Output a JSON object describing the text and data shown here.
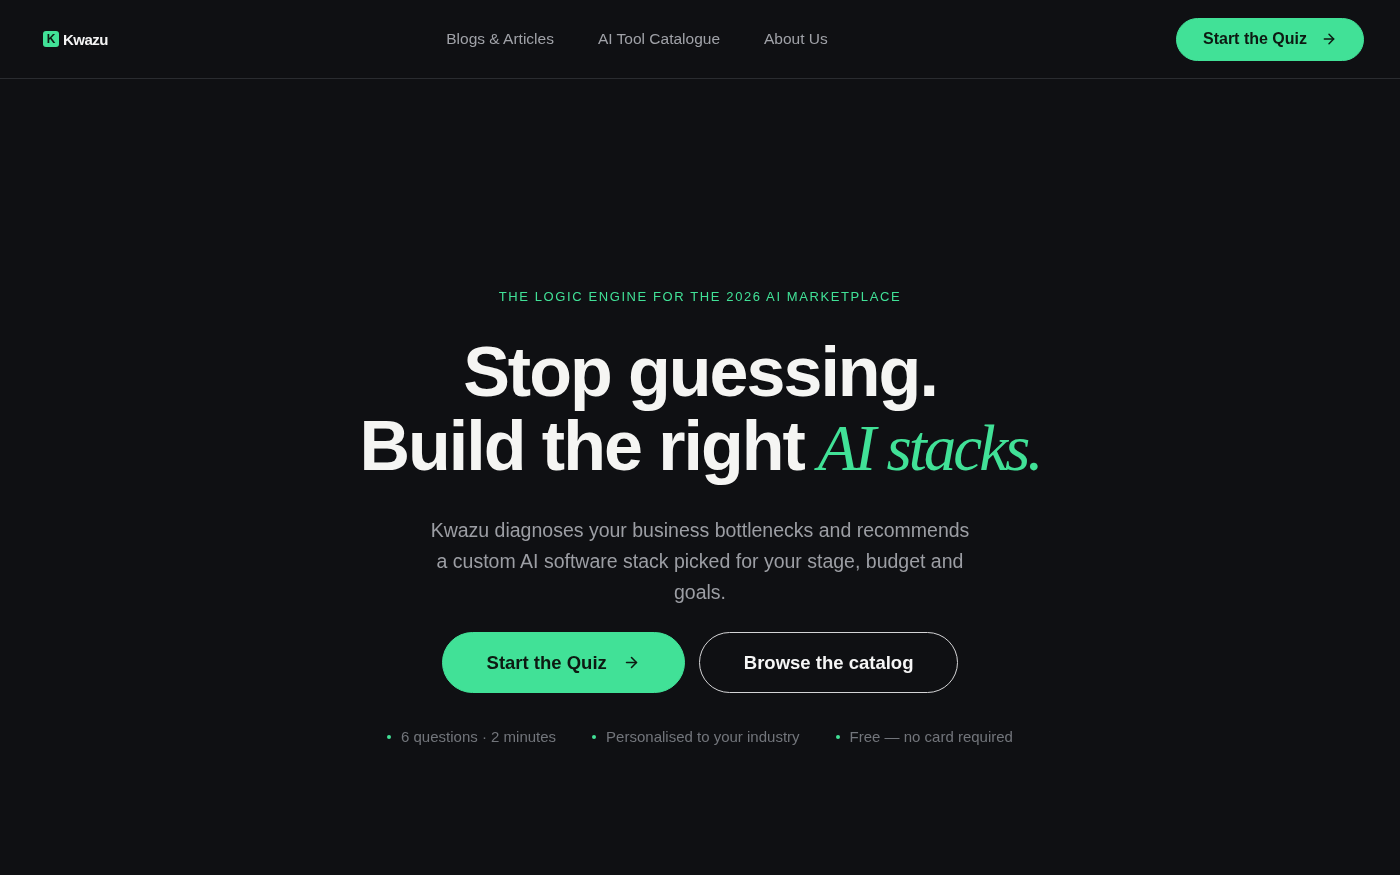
{
  "header": {
    "logo": {
      "mark": "K",
      "name": "Kwazu"
    },
    "nav": [
      {
        "label": "Blogs & Articles"
      },
      {
        "label": "AI Tool Catalogue"
      },
      {
        "label": "About Us"
      }
    ],
    "cta": {
      "label": "Start the Quiz"
    }
  },
  "hero": {
    "eyebrow": "THE LOGIC ENGINE FOR THE 2026 AI MARKETPLACE",
    "headline": {
      "line_1": "Stop guessing.",
      "line_2": "Build the right",
      "accent": "AI stacks."
    },
    "description": "Kwazu diagnoses your business bottlenecks and recommends a custom AI software stack picked for your stage, budget and goals.",
    "buttons": [
      {
        "kind": "primary",
        "label": "Start the Quiz"
      },
      {
        "kind": "outline",
        "label": "Browse the catalog"
      }
    ],
    "highlights": [
      "6 questions · 2 minutes",
      "Personalised to your industry",
      "Free — no card required"
    ]
  }
}
